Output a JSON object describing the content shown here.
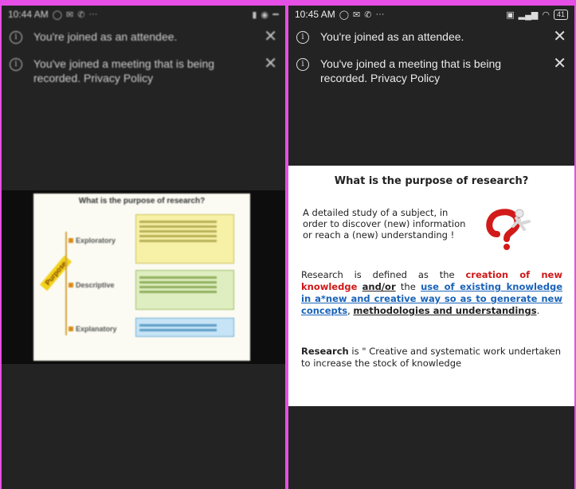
{
  "left": {
    "status": {
      "time": "10:44 AM",
      "battery": ""
    },
    "notices": [
      {
        "text": "You're joined as an attendee."
      },
      {
        "text": "You've joined a meeting that is being recorded. Privacy Policy"
      }
    ],
    "slide": {
      "title": "What is the purpose of research?",
      "purpose_label": "Purpose",
      "items": [
        "Exploratory",
        "Descriptive",
        "Explanatory"
      ]
    }
  },
  "right": {
    "status": {
      "time": "10:45 AM",
      "battery": "41"
    },
    "notices": [
      {
        "text": "You're joined as an attendee."
      },
      {
        "text": "You've joined a meeting that is being recorded. Privacy Policy"
      }
    ],
    "slide": {
      "title": "What is the purpose of research?",
      "definition": "A detailed study of a subject, in order to discover (new) information or reach a (new) understanding !",
      "p1": {
        "a": "Research is defined as the ",
        "b": "creation of new knowledge",
        "c": " ",
        "d": "and/or",
        "e": " the ",
        "f": "use of existing knowledge in a*new and creative way so as to generate new concepts",
        "g": ", ",
        "h": "methodologies and understandings",
        "i": "."
      },
      "p2": {
        "a": "Research",
        "b": " is \" Creative and systematic work undertaken to increase the stock of knowledge"
      }
    }
  },
  "colors": {
    "background": "#e64fe6",
    "phone": "#232323",
    "red": "#d01818",
    "blue": "#1a63b8"
  }
}
